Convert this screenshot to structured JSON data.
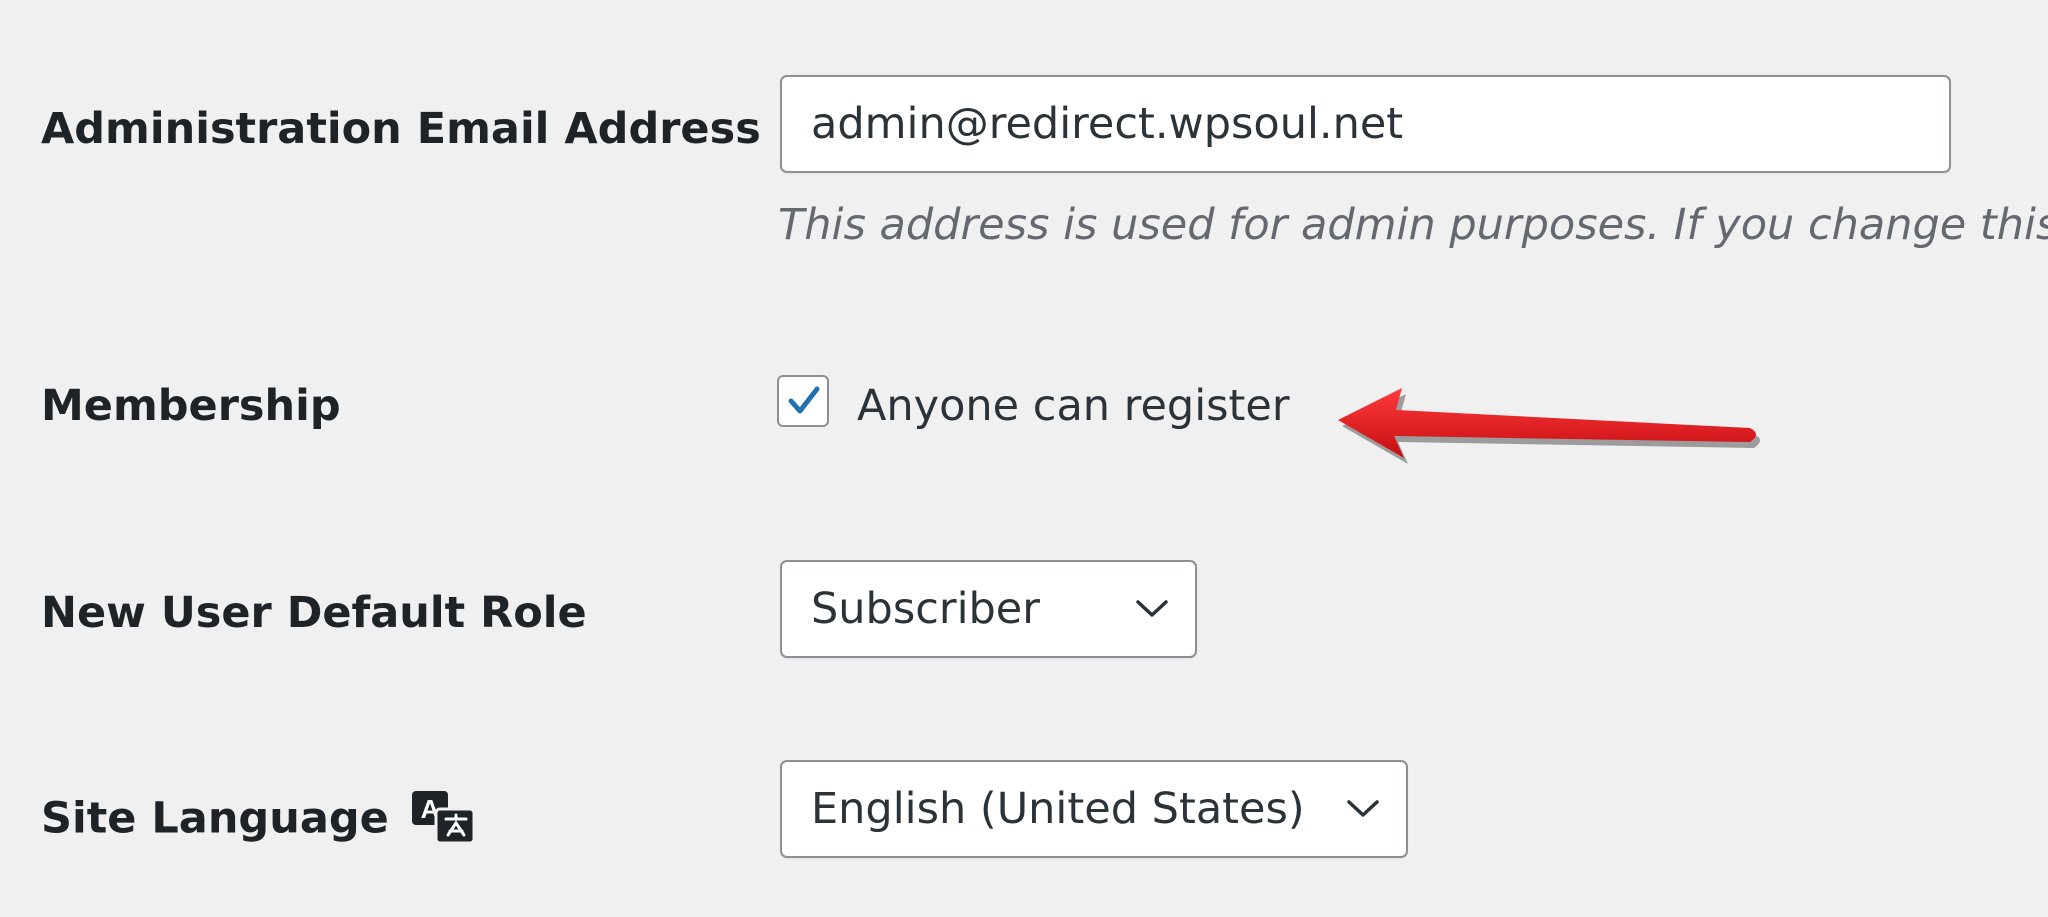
{
  "fields": {
    "admin_email": {
      "label": "Administration Email Address",
      "value": "admin@redirect.wpsoul.net",
      "description": "This address is used for admin purposes. If you change this, we"
    },
    "membership": {
      "label": "Membership",
      "checkbox_label": "Anyone can register",
      "checked": true
    },
    "default_role": {
      "label": "New User Default Role",
      "selected": "Subscriber"
    },
    "site_language": {
      "label": "Site Language",
      "selected": "English (United States)"
    }
  },
  "icons": {
    "translation": "translation-icon",
    "chevron": "chevron-down-icon",
    "check": "checkmark-icon",
    "annotation_arrow": "arrow-left-icon"
  },
  "colors": {
    "background": "#f0f0f1",
    "accent": "#2271b1",
    "annotation": "#e8141c"
  }
}
